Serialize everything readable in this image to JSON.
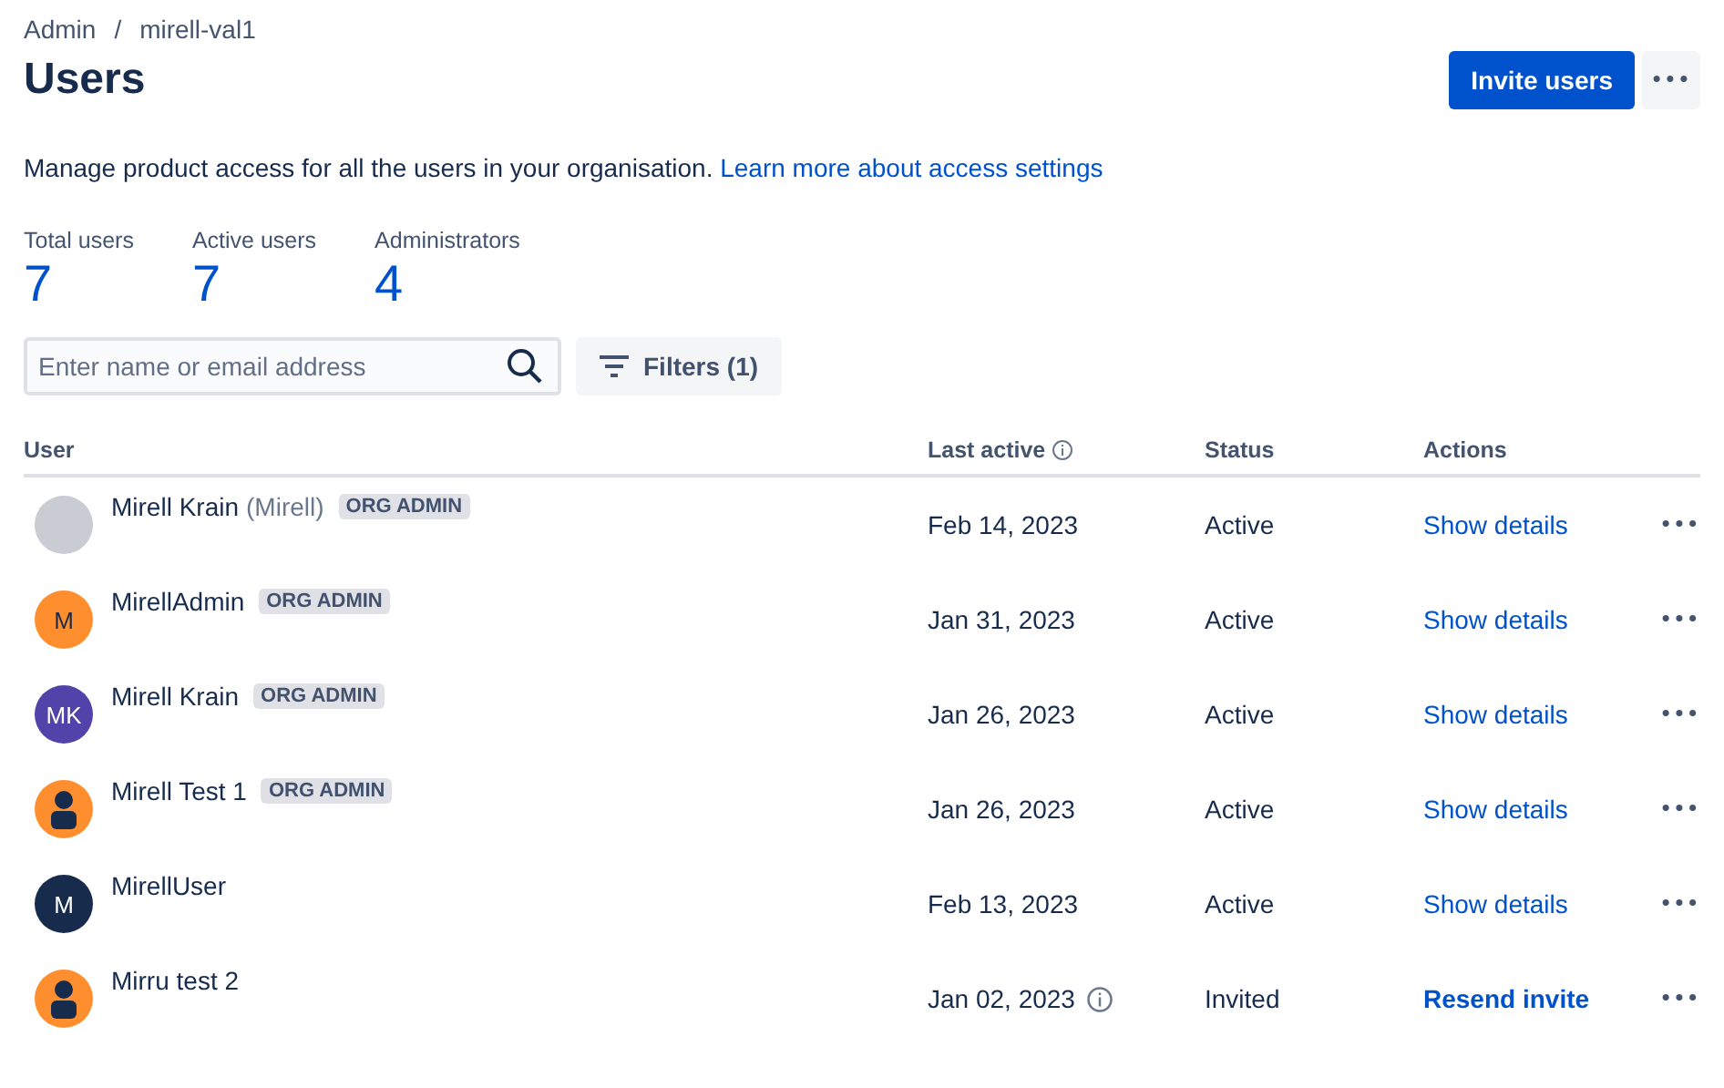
{
  "breadcrumbs": {
    "items": [
      "Admin",
      "mirell-val1"
    ],
    "separator": "/"
  },
  "title": "Users",
  "header_buttons": {
    "primary": "Invite users",
    "more": "•••"
  },
  "description": {
    "text": "Manage product access for all the users in your organisation.",
    "link": "Learn more about access settings"
  },
  "stats": [
    {
      "label": "Total users",
      "value": "7"
    },
    {
      "label": "Active users",
      "value": "7"
    },
    {
      "label": "Administrators",
      "value": "4"
    }
  ],
  "search": {
    "placeholder": "Enter name or email address"
  },
  "filters": {
    "label": "Filters (1)"
  },
  "table": {
    "columns": [
      {
        "label": "User",
        "info": false
      },
      {
        "label": "Last active",
        "info": true
      },
      {
        "label": "Status",
        "info": false
      },
      {
        "label": "Actions",
        "info": false
      }
    ],
    "rows": [
      {
        "avatar": {
          "kind": "photo",
          "color": "#c9ccd3"
        },
        "name": "Mirell Krain",
        "nickname": "(Mirell)",
        "badge": "ORG ADMIN",
        "last_active": "Feb 14, 2023",
        "date_info": false,
        "status": "Active",
        "action": {
          "kind": "link",
          "label": "Show details"
        },
        "more": "•••"
      },
      {
        "avatar": {
          "kind": "initials",
          "initials": "M",
          "color": "#ff8f2e"
        },
        "name": "MirellAdmin",
        "badge": "ORG ADMIN",
        "last_active": "Jan 31, 2023",
        "date_info": false,
        "status": "Active",
        "action": {
          "kind": "link",
          "label": "Show details"
        },
        "more": "•••"
      },
      {
        "avatar": {
          "kind": "initials",
          "initials": "MK",
          "color": "#5243aa"
        },
        "name": "Mirell Krain",
        "badge": "ORG ADMIN",
        "last_active": "Jan 26, 2023",
        "date_info": false,
        "status": "Active",
        "action": {
          "kind": "link",
          "label": "Show details"
        },
        "more": "•••"
      },
      {
        "avatar": {
          "kind": "person",
          "color": "#ff8f2e"
        },
        "name": "Mirell Test 1",
        "badge": "ORG ADMIN",
        "last_active": "Jan 26, 2023",
        "date_info": false,
        "status": "Active",
        "action": {
          "kind": "link",
          "label": "Show details"
        },
        "more": "•••"
      },
      {
        "avatar": {
          "kind": "initials",
          "initials": "M",
          "color": "#172b4d"
        },
        "name": "MirellUser",
        "last_active": "Feb 13, 2023",
        "date_info": false,
        "status": "Active",
        "action": {
          "kind": "link",
          "label": "Show details"
        },
        "more": "•••"
      },
      {
        "avatar": {
          "kind": "person",
          "color": "#ff8f2e"
        },
        "name": "Mirru test 2",
        "last_active": "Jan 02, 2023",
        "date_info": true,
        "status": "Invited",
        "action": {
          "kind": "strong",
          "label": "Resend invite"
        },
        "more": "•••"
      }
    ]
  }
}
